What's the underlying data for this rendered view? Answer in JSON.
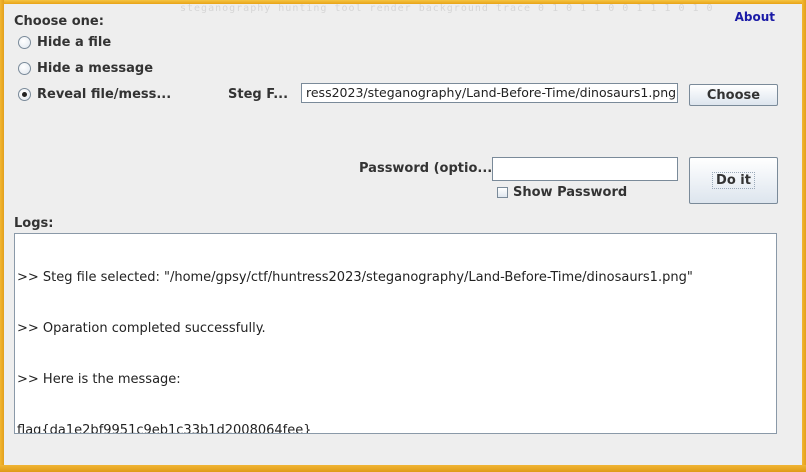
{
  "header": {
    "choose_label": "Choose one:",
    "about_label": "About",
    "ghost_text": "steganography hunting tool render background trace 0 1 0 1 1 0 0 1 1 1 0 1 0 0 1 0"
  },
  "mode": {
    "options": [
      {
        "label": "Hide a file",
        "selected": false
      },
      {
        "label": "Hide a message",
        "selected": false
      },
      {
        "label": "Reveal file/mess...",
        "selected": true
      }
    ]
  },
  "steg_file": {
    "label": "Steg F...",
    "value": "ress2023/steganography/Land-Before-Time/dinosaurs1.png",
    "choose_button": "Choose"
  },
  "password": {
    "label": "Password (optio...",
    "value": "",
    "show_password_label": "Show Password",
    "show_password_checked": false,
    "do_it_button": "Do it"
  },
  "logs": {
    "label": "Logs:",
    "lines": [
      ">> Steg file selected: \"/home/gpsy/ctf/huntress2023/steganography/Land-Before-Time/dinosaurs1.png\"",
      ">> Oparation completed successfully.",
      ">> Here is the message:",
      "flag{da1e2bf9951c9eb1c33b1d2008064fee}"
    ]
  },
  "colors": {
    "frame": "#e8a317",
    "about_link": "#1a1aa6",
    "panel": "#eeeeee"
  }
}
